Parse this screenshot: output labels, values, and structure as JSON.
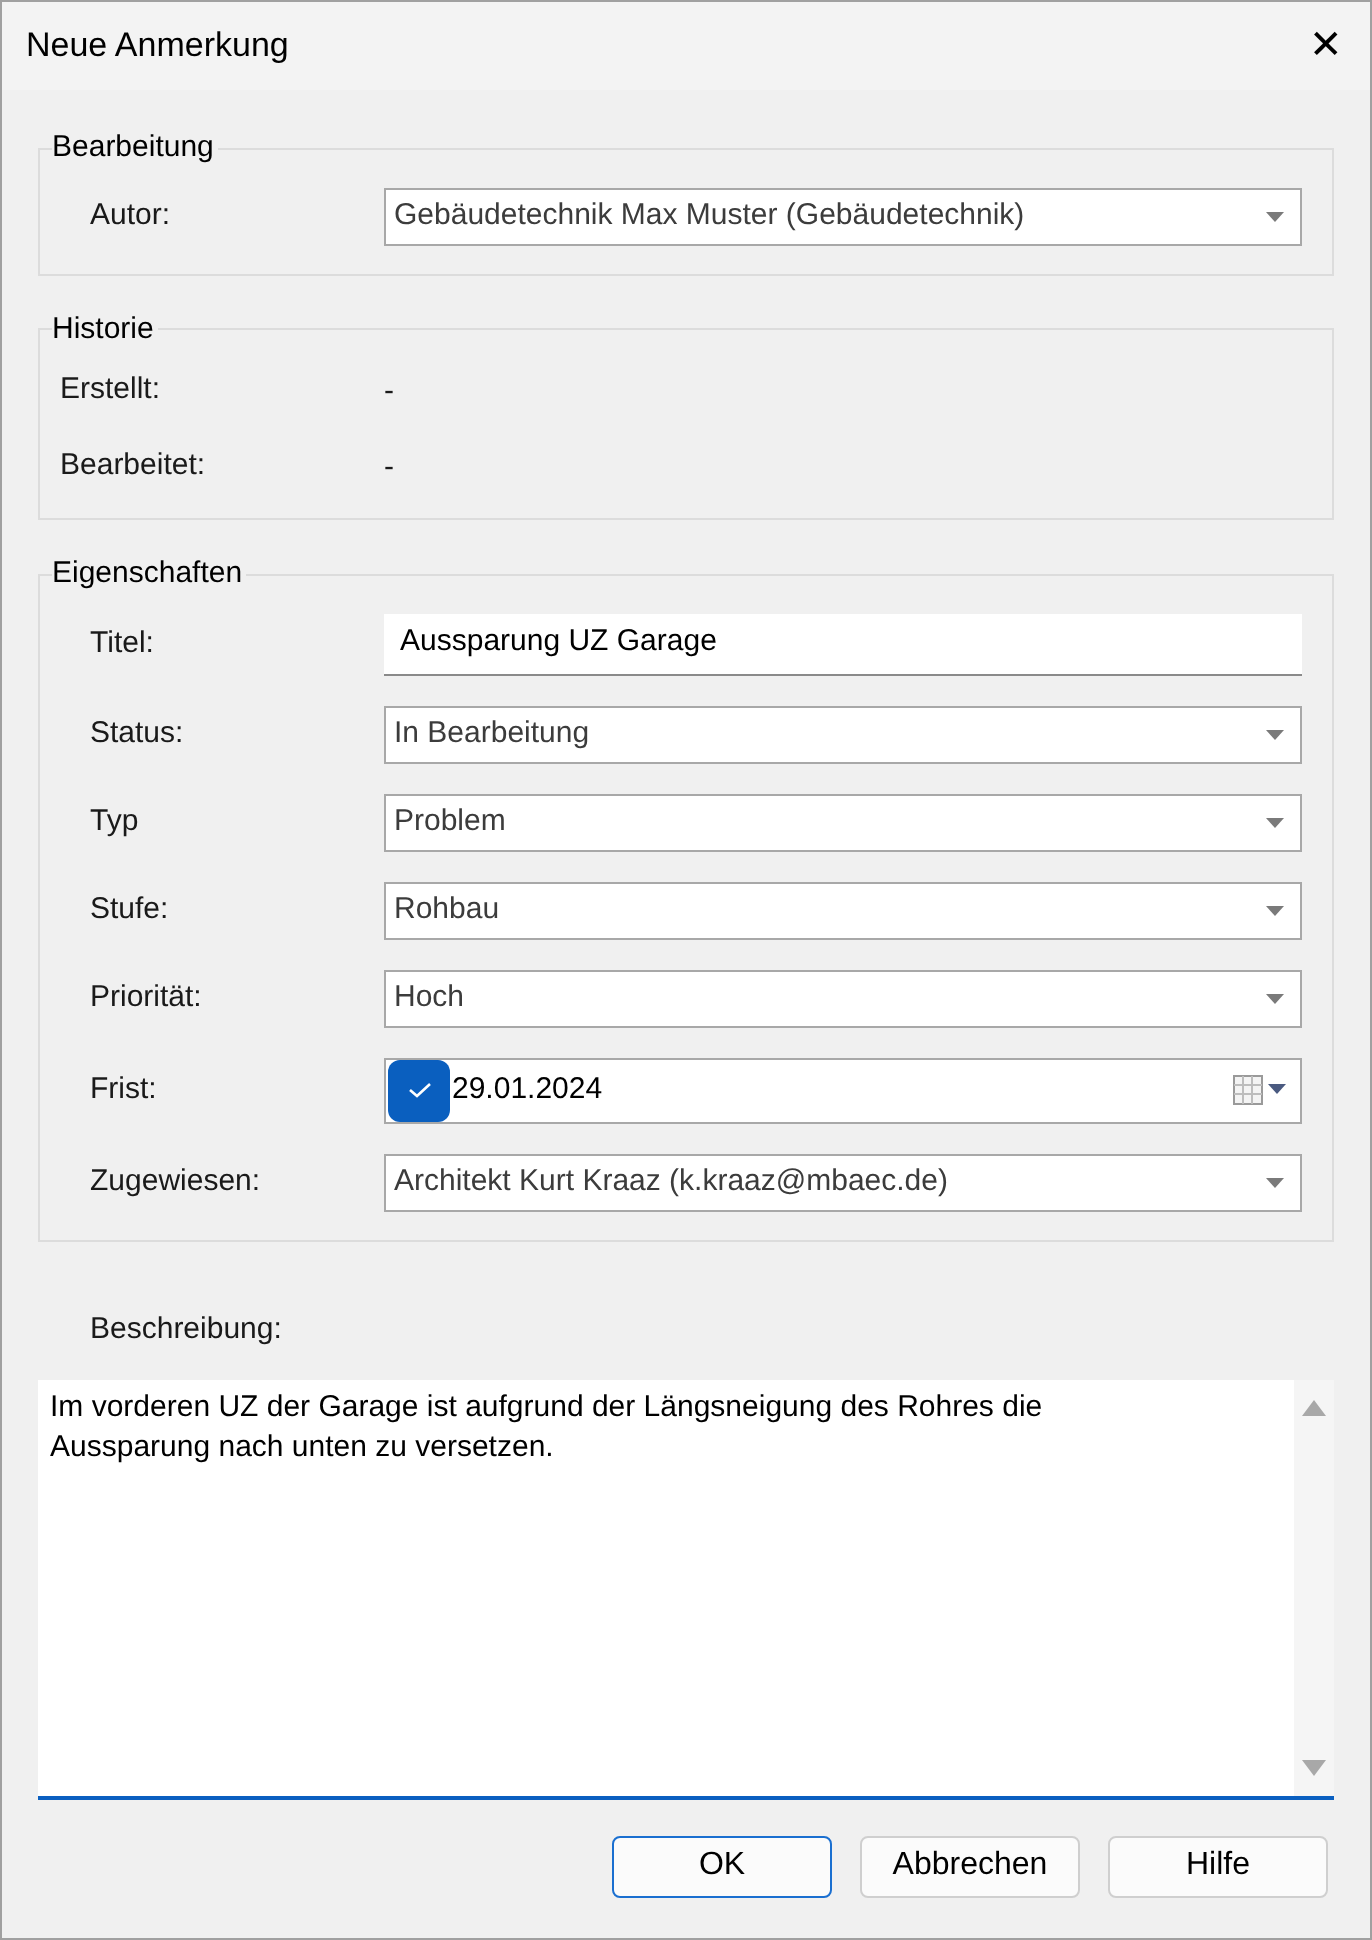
{
  "window": {
    "title": "Neue Anmerkung",
    "close": "✕"
  },
  "groups": [
    {
      "title": "Bearbeitung",
      "fields": [
        {
          "kind": "combo",
          "label": "Autor:",
          "value": "Gebäudetechnik Max Muster (Gebäudetechnik)"
        }
      ]
    },
    {
      "title": "Historie",
      "fields": [
        {
          "kind": "readonly",
          "label": "Erstellt:",
          "value": "-"
        },
        {
          "kind": "readonly",
          "label": "Bearbeitet:",
          "value": "-"
        }
      ]
    },
    {
      "title": "Eigenschaften",
      "fields": [
        {
          "kind": "text",
          "label": "Titel:",
          "value": "Aussparung UZ Garage"
        },
        {
          "kind": "combo",
          "label": "Status:",
          "value": "In Bearbeitung"
        },
        {
          "kind": "combo",
          "label": "Typ",
          "value": "Problem"
        },
        {
          "kind": "combo",
          "label": "Stufe:",
          "value": "Rohbau"
        },
        {
          "kind": "combo",
          "label": "Priorität:",
          "value": "Hoch"
        },
        {
          "kind": "date",
          "label": "Frist:",
          "value": "29.01.2024",
          "checked": true
        },
        {
          "kind": "combo",
          "label": "Zugewiesen:",
          "value": "Architekt Kurt Kraaz (k.kraaz@mbaec.de)"
        }
      ]
    }
  ],
  "description": {
    "label": "Beschreibung:",
    "lines": [
      "Im vorderen UZ der Garage ist aufgrund der Längsneigung des Rohres die",
      "Aussparung nach unten zu versetzen."
    ]
  },
  "buttons": [
    {
      "label": "OK",
      "default": true
    },
    {
      "label": "Abbrechen",
      "default": false
    },
    {
      "label": "Hilfe",
      "default": false
    }
  ]
}
